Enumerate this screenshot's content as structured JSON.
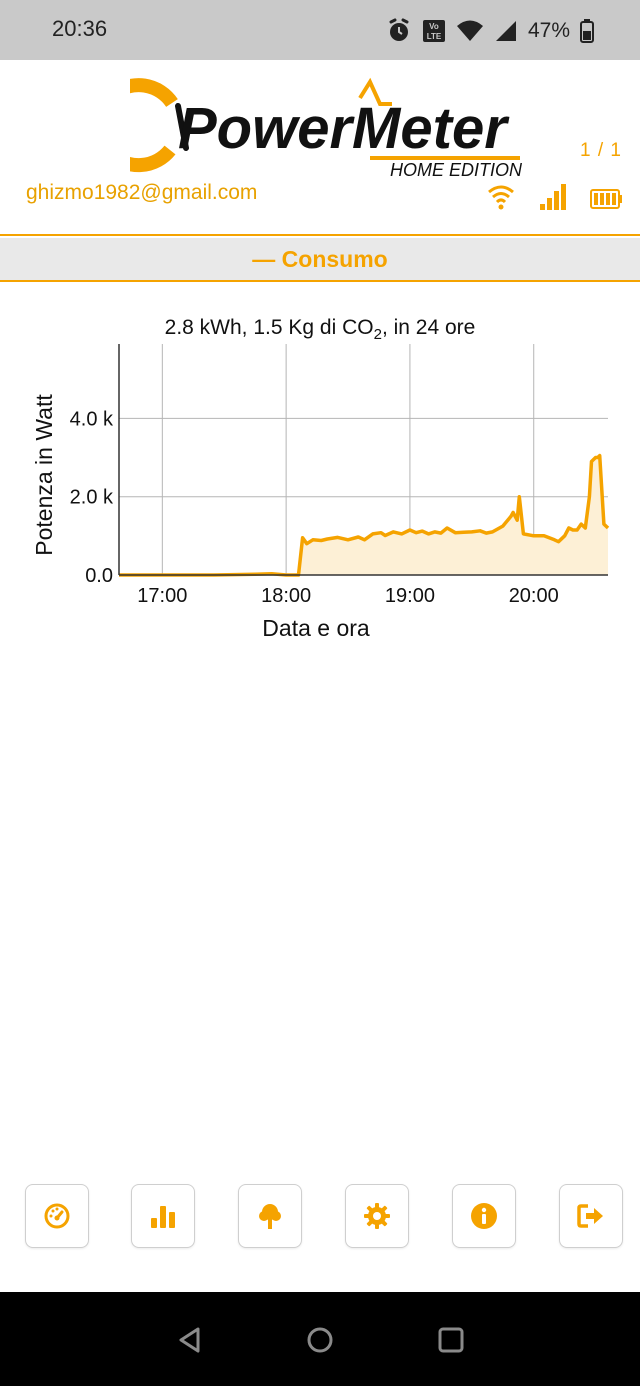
{
  "status_bar": {
    "time": "20:36",
    "battery_percent": "47%",
    "icons": [
      "alarm-icon",
      "volte-icon",
      "wifi-icon",
      "cell-signal-icon",
      "battery-icon"
    ]
  },
  "header": {
    "logo_text": "PowerMeter",
    "logo_subtitle": "HOME EDITION",
    "page_counter": "1 / 1",
    "email": "ghizmo1982@gmail.com",
    "icons": [
      "wifi-icon",
      "signal-bars-icon",
      "battery-icon"
    ]
  },
  "section": {
    "title": "— Consumo"
  },
  "chart_data": {
    "type": "area",
    "title": "2.8 kWh, 1.5 Kg di CO₂, in 24 ore",
    "title_parts": {
      "pre": "2.8 kWh, 1.5 Kg di CO",
      "sub": "2",
      "post": ", in 24 ore"
    },
    "xlabel": "Data e ora",
    "ylabel": "Potenza in Watt",
    "xlim": [
      "16:39",
      "20:36"
    ],
    "x_ticks": [
      {
        "t": "17:00",
        "label": "17:00"
      },
      {
        "t": "18:00",
        "label": "18:00"
      },
      {
        "t": "19:00",
        "label": "19:00"
      },
      {
        "t": "20:00",
        "label": "20:00"
      }
    ],
    "ylim": [
      0,
      5900
    ],
    "y_ticks": [
      {
        "v": 0,
        "label": "0.0"
      },
      {
        "v": 2000,
        "label": "2.0 k"
      },
      {
        "v": 4000,
        "label": "4.0 k"
      }
    ],
    "grid": true,
    "colors": {
      "line": "#f5a300",
      "fill": "#fdf0d6",
      "grid": "#b5b5b5"
    },
    "x": [
      "16:39",
      "17:25",
      "17:45",
      "17:53",
      "18:00",
      "18:06",
      "18:08",
      "18:10",
      "18:13",
      "18:17",
      "18:20",
      "18:25",
      "18:30",
      "18:35",
      "18:38",
      "18:42",
      "18:46",
      "18:48",
      "18:52",
      "18:56",
      "19:00",
      "19:03",
      "19:06",
      "19:09",
      "19:12",
      "19:15",
      "19:18",
      "19:22",
      "19:26",
      "19:30",
      "19:34",
      "19:37",
      "19:40",
      "19:45",
      "19:49",
      "19:50",
      "19:52",
      "19:53",
      "19:55",
      "20:00",
      "20:05",
      "20:10",
      "20:12",
      "20:15",
      "20:17",
      "20:19",
      "20:21",
      "20:23",
      "20:25",
      "20:27",
      "20:28",
      "20:30",
      "20:31",
      "20:32",
      "20:34",
      "20:36"
    ],
    "y": [
      0,
      0,
      20,
      30,
      0,
      0,
      950,
      800,
      900,
      880,
      920,
      960,
      900,
      970,
      900,
      1050,
      1080,
      1010,
      1100,
      1050,
      1150,
      1080,
      1120,
      1050,
      1100,
      1070,
      1200,
      1080,
      1090,
      1100,
      1130,
      1070,
      1100,
      1250,
      1500,
      1600,
      1400,
      2000,
      1050,
      1000,
      1000,
      900,
      850,
      1000,
      1200,
      1150,
      1150,
      1300,
      1200,
      2000,
      2900,
      3000,
      3000,
      3050,
      1300,
      1200
    ]
  },
  "toolbar": {
    "buttons": [
      {
        "name": "dashboard-button",
        "icon": "gauge-icon"
      },
      {
        "name": "statistics-button",
        "icon": "bar-chart-icon"
      },
      {
        "name": "eco-button",
        "icon": "tree-icon"
      },
      {
        "name": "settings-button",
        "icon": "gear-icon"
      },
      {
        "name": "info-button",
        "icon": "info-icon"
      },
      {
        "name": "logout-button",
        "icon": "logout-icon"
      }
    ]
  },
  "nav_bar": {
    "buttons": [
      "back-icon",
      "home-icon",
      "recents-icon"
    ]
  }
}
